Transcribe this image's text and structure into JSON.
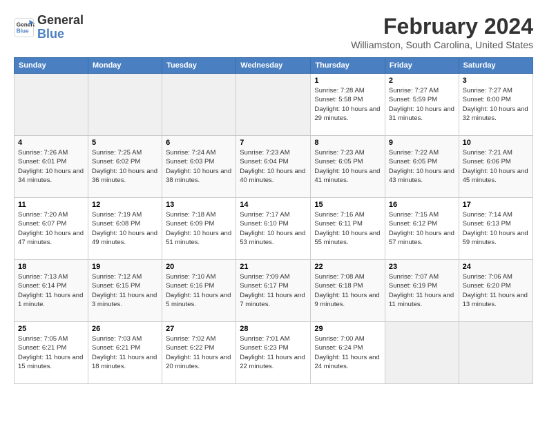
{
  "app": {
    "logo_line1": "General",
    "logo_line2": "Blue"
  },
  "header": {
    "month": "February 2024",
    "location": "Williamston, South Carolina, United States"
  },
  "weekdays": [
    "Sunday",
    "Monday",
    "Tuesday",
    "Wednesday",
    "Thursday",
    "Friday",
    "Saturday"
  ],
  "weeks": [
    [
      {
        "day": "",
        "empty": true
      },
      {
        "day": "",
        "empty": true
      },
      {
        "day": "",
        "empty": true
      },
      {
        "day": "",
        "empty": true
      },
      {
        "day": "1",
        "sunrise": "7:28 AM",
        "sunset": "5:58 PM",
        "daylight": "10 hours and 29 minutes."
      },
      {
        "day": "2",
        "sunrise": "7:27 AM",
        "sunset": "5:59 PM",
        "daylight": "10 hours and 31 minutes."
      },
      {
        "day": "3",
        "sunrise": "7:27 AM",
        "sunset": "6:00 PM",
        "daylight": "10 hours and 32 minutes."
      }
    ],
    [
      {
        "day": "4",
        "sunrise": "7:26 AM",
        "sunset": "6:01 PM",
        "daylight": "10 hours and 34 minutes."
      },
      {
        "day": "5",
        "sunrise": "7:25 AM",
        "sunset": "6:02 PM",
        "daylight": "10 hours and 36 minutes."
      },
      {
        "day": "6",
        "sunrise": "7:24 AM",
        "sunset": "6:03 PM",
        "daylight": "10 hours and 38 minutes."
      },
      {
        "day": "7",
        "sunrise": "7:23 AM",
        "sunset": "6:04 PM",
        "daylight": "10 hours and 40 minutes."
      },
      {
        "day": "8",
        "sunrise": "7:23 AM",
        "sunset": "6:05 PM",
        "daylight": "10 hours and 41 minutes."
      },
      {
        "day": "9",
        "sunrise": "7:22 AM",
        "sunset": "6:05 PM",
        "daylight": "10 hours and 43 minutes."
      },
      {
        "day": "10",
        "sunrise": "7:21 AM",
        "sunset": "6:06 PM",
        "daylight": "10 hours and 45 minutes."
      }
    ],
    [
      {
        "day": "11",
        "sunrise": "7:20 AM",
        "sunset": "6:07 PM",
        "daylight": "10 hours and 47 minutes."
      },
      {
        "day": "12",
        "sunrise": "7:19 AM",
        "sunset": "6:08 PM",
        "daylight": "10 hours and 49 minutes."
      },
      {
        "day": "13",
        "sunrise": "7:18 AM",
        "sunset": "6:09 PM",
        "daylight": "10 hours and 51 minutes."
      },
      {
        "day": "14",
        "sunrise": "7:17 AM",
        "sunset": "6:10 PM",
        "daylight": "10 hours and 53 minutes."
      },
      {
        "day": "15",
        "sunrise": "7:16 AM",
        "sunset": "6:11 PM",
        "daylight": "10 hours and 55 minutes."
      },
      {
        "day": "16",
        "sunrise": "7:15 AM",
        "sunset": "6:12 PM",
        "daylight": "10 hours and 57 minutes."
      },
      {
        "day": "17",
        "sunrise": "7:14 AM",
        "sunset": "6:13 PM",
        "daylight": "10 hours and 59 minutes."
      }
    ],
    [
      {
        "day": "18",
        "sunrise": "7:13 AM",
        "sunset": "6:14 PM",
        "daylight": "11 hours and 1 minute."
      },
      {
        "day": "19",
        "sunrise": "7:12 AM",
        "sunset": "6:15 PM",
        "daylight": "11 hours and 3 minutes."
      },
      {
        "day": "20",
        "sunrise": "7:10 AM",
        "sunset": "6:16 PM",
        "daylight": "11 hours and 5 minutes."
      },
      {
        "day": "21",
        "sunrise": "7:09 AM",
        "sunset": "6:17 PM",
        "daylight": "11 hours and 7 minutes."
      },
      {
        "day": "22",
        "sunrise": "7:08 AM",
        "sunset": "6:18 PM",
        "daylight": "11 hours and 9 minutes."
      },
      {
        "day": "23",
        "sunrise": "7:07 AM",
        "sunset": "6:19 PM",
        "daylight": "11 hours and 11 minutes."
      },
      {
        "day": "24",
        "sunrise": "7:06 AM",
        "sunset": "6:20 PM",
        "daylight": "11 hours and 13 minutes."
      }
    ],
    [
      {
        "day": "25",
        "sunrise": "7:05 AM",
        "sunset": "6:21 PM",
        "daylight": "11 hours and 15 minutes."
      },
      {
        "day": "26",
        "sunrise": "7:03 AM",
        "sunset": "6:21 PM",
        "daylight": "11 hours and 18 minutes."
      },
      {
        "day": "27",
        "sunrise": "7:02 AM",
        "sunset": "6:22 PM",
        "daylight": "11 hours and 20 minutes."
      },
      {
        "day": "28",
        "sunrise": "7:01 AM",
        "sunset": "6:23 PM",
        "daylight": "11 hours and 22 minutes."
      },
      {
        "day": "29",
        "sunrise": "7:00 AM",
        "sunset": "6:24 PM",
        "daylight": "11 hours and 24 minutes."
      },
      {
        "day": "",
        "empty": true
      },
      {
        "day": "",
        "empty": true
      }
    ]
  ]
}
